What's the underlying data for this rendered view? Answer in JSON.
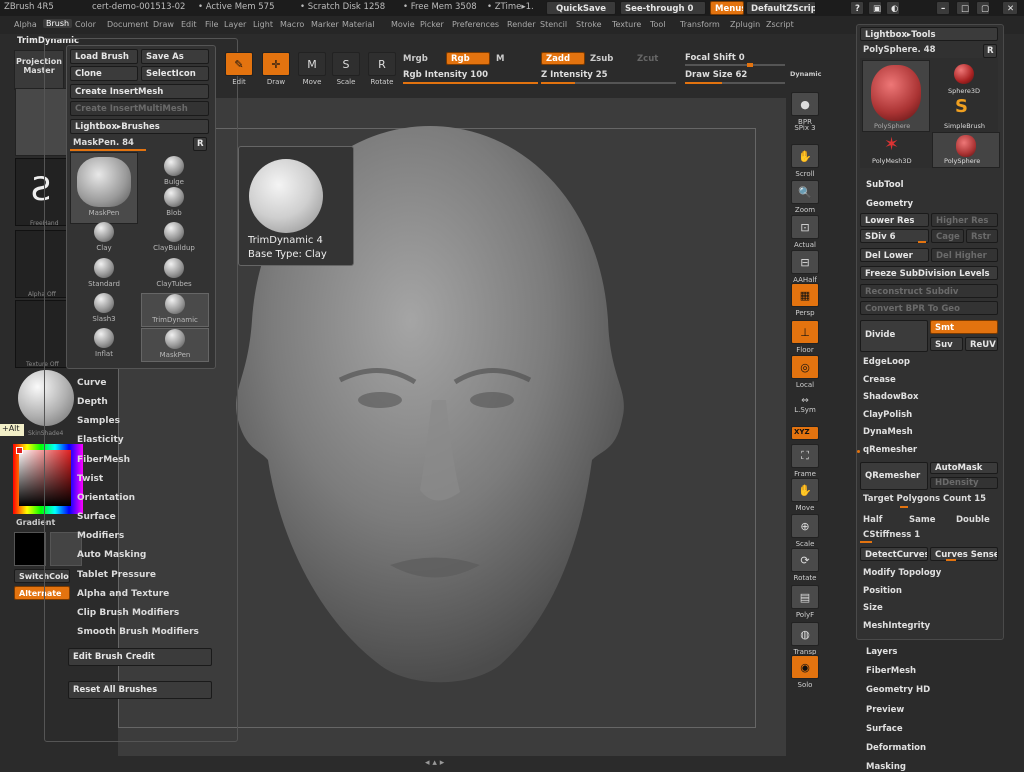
{
  "titlebar": {
    "app": "ZBrush 4R5",
    "session": "cert-demo-001513-02",
    "active_mem": "• Active Mem 575",
    "scratch_disk": "• Scratch Disk 1258",
    "free_mem": "• Free Mem 3508",
    "ztime": "• ZTime▸1.",
    "quicksave": "QuickSave",
    "see_through": "See-through  0",
    "menus": "Menus",
    "default_script": "DefaultZScript"
  },
  "menubar": [
    "Alpha",
    "Brush",
    "Color",
    "Document",
    "Draw",
    "Edit",
    "File",
    "Layer",
    "Light",
    "Macro",
    "Marker",
    "Material",
    "Movie",
    "Picker",
    "Preferences",
    "Render",
    "Stencil",
    "Stroke",
    "Texture",
    "Tool",
    "Transform",
    "Zplugin",
    "Zscript"
  ],
  "menubar_selected": "Brush",
  "brush_title": "TrimDynamic",
  "left_shelf": {
    "projection_master": "Projection Master",
    "freehand": "FreeHand",
    "alpha_off": "Alpha Off",
    "texture_off": "Texture Off",
    "material": "SkinShade4",
    "gradient": "Gradient",
    "switch_color": "SwitchColor",
    "alternate": "Alternate",
    "tooltip": "+Alt"
  },
  "brush_menu": {
    "load_brush": "Load Brush",
    "save_as": "Save As",
    "clone": "Clone",
    "select_icon": "SelectIcon",
    "create_insert_mesh": "Create InsertMesh",
    "create_insert_multimesh": "Create InsertMultiMesh",
    "lightbox_brushes": "Lightbox▸Brushes",
    "current_brush": "MaskPen. 84",
    "r": "R",
    "brushes": [
      {
        "name": "MaskPen",
        "icon": "maskpen-icon"
      },
      {
        "name": "Bulge",
        "icon": "bulge-icon"
      },
      {
        "name": "Blob",
        "icon": "blob-icon"
      },
      {
        "name": "Clay",
        "icon": "clay-icon"
      },
      {
        "name": "ClayBuildup",
        "icon": "claybuildup-icon"
      },
      {
        "name": "Standard",
        "icon": "standard-icon"
      },
      {
        "name": "ClayTubes",
        "icon": "claytubes-icon"
      },
      {
        "name": "Slash3",
        "icon": "slash3-icon"
      },
      {
        "name": "TrimDynamic",
        "icon": "trimdynamic-icon"
      },
      {
        "name": "Inflat",
        "icon": "inflat-icon"
      },
      {
        "name": "MaskPen",
        "icon": "maskpen-icon"
      }
    ],
    "sections": [
      "Curve",
      "Depth",
      "Samples",
      "Elasticity",
      "FiberMesh",
      "Twist",
      "Orientation",
      "Surface",
      "Modifiers",
      "Auto Masking",
      "Tablet Pressure",
      "Alpha and Texture",
      "Clip Brush Modifiers",
      "Smooth Brush Modifiers"
    ],
    "edit_brush_credit": "Edit Brush Credit",
    "reset_all_brushes": "Reset All Brushes"
  },
  "tooltip": {
    "name": "TrimDynamic  4",
    "base": "Base Type: Clay"
  },
  "top_toolbar": {
    "edit": "Edit",
    "draw": "Draw",
    "move": "Move",
    "scale": "Scale",
    "rotate": "Rotate",
    "mrgb": "Mrgb",
    "rgb": "Rgb",
    "m": "M",
    "rgb_intensity": "Rgb Intensity 100",
    "zadd": "Zadd",
    "zsub": "Zsub",
    "zcut": "Zcut",
    "z_intensity": "Z Intensity 25",
    "focal_shift": "Focal Shift 0",
    "draw_size": "Draw Size 62",
    "dynamic": "Dynamic",
    "rgb_intensity_value": 100,
    "z_intensity_value": 25,
    "draw_size_value": 62
  },
  "right_shelf": [
    {
      "label": "BPR",
      "icon": "bpr-icon",
      "on": false
    },
    {
      "label": "SPix 3",
      "icon": "spix-icon",
      "on": false
    },
    {
      "label": "Scroll",
      "icon": "scroll-icon",
      "on": false
    },
    {
      "label": "Zoom",
      "icon": "zoom-icon",
      "on": false
    },
    {
      "label": "Actual",
      "icon": "actual-icon",
      "on": false
    },
    {
      "label": "AAHalf",
      "icon": "aahalf-icon",
      "on": false
    },
    {
      "label": "Persp",
      "icon": "persp-icon",
      "on": true
    },
    {
      "label": "Floor",
      "icon": "floor-icon",
      "on": true
    },
    {
      "label": "Local",
      "icon": "local-icon",
      "on": true
    },
    {
      "label": "L.Sym",
      "icon": "lsym-icon",
      "on": false
    },
    {
      "label": "XYZ",
      "icon": "xyz-icon",
      "on": true
    },
    {
      "label": "Frame",
      "icon": "frame-icon",
      "on": false
    },
    {
      "label": "Move",
      "icon": "move-icon",
      "on": false
    },
    {
      "label": "Scale",
      "icon": "scale-icon",
      "on": false
    },
    {
      "label": "Rotate",
      "icon": "rotate-icon",
      "on": false
    },
    {
      "label": "PolyF",
      "icon": "polyf-icon",
      "on": false
    },
    {
      "label": "Transp",
      "icon": "transp-icon",
      "on": false
    },
    {
      "label": "Solo",
      "icon": "solo-icon",
      "on": true
    }
  ],
  "tool_panel": {
    "lightbox_tools": "Lightbox▸Tools",
    "current_tool": "PolySphere. 48",
    "r": "R",
    "tools": [
      "PolySphere",
      "Sphere3D",
      "SimpleBrush",
      "PolyMesh3D",
      "PolySphere"
    ],
    "subtool": "SubTool",
    "geometry": "Geometry",
    "lower_res": "Lower Res",
    "higher_res": "Higher Res",
    "sdiv": "SDiv 6",
    "cage": "Cage",
    "rstr": "Rstr",
    "del_lower": "Del Lower",
    "del_higher": "Del Higher",
    "freeze_subdiv": "Freeze SubDivision Levels",
    "reconstruct_subdiv": "Reconstruct Subdiv",
    "convert_bpr": "Convert BPR To Geo",
    "divide": "Divide",
    "smt": "Smt",
    "suv": "Suv",
    "reuv": "ReUV",
    "items1": [
      "EdgeLoop",
      "Crease",
      "ShadowBox",
      "ClayPolish",
      "DynaMesh",
      "qRemesher"
    ],
    "qremesher": "QRemesher",
    "automask": "AutoMask",
    "hdensity": "HDensity",
    "target_polygons": "Target Polygons Count 15",
    "half": "Half",
    "same": "Same",
    "double": "Double",
    "cstiffness": "CStiffness 1",
    "detect_curves": "DetectCurves",
    "curves_sense": "Curves Sense",
    "items2": [
      "Modify Topology",
      "Position",
      "Size",
      "MeshIntegrity"
    ],
    "items3": [
      "Layers",
      "FiberMesh",
      "Geometry HD",
      "Preview",
      "Surface",
      "Deformation",
      "Masking"
    ]
  },
  "colors": {
    "accent": "#e3730f",
    "bg": "#2b2b2b",
    "canvas": "#3c3c3c"
  }
}
